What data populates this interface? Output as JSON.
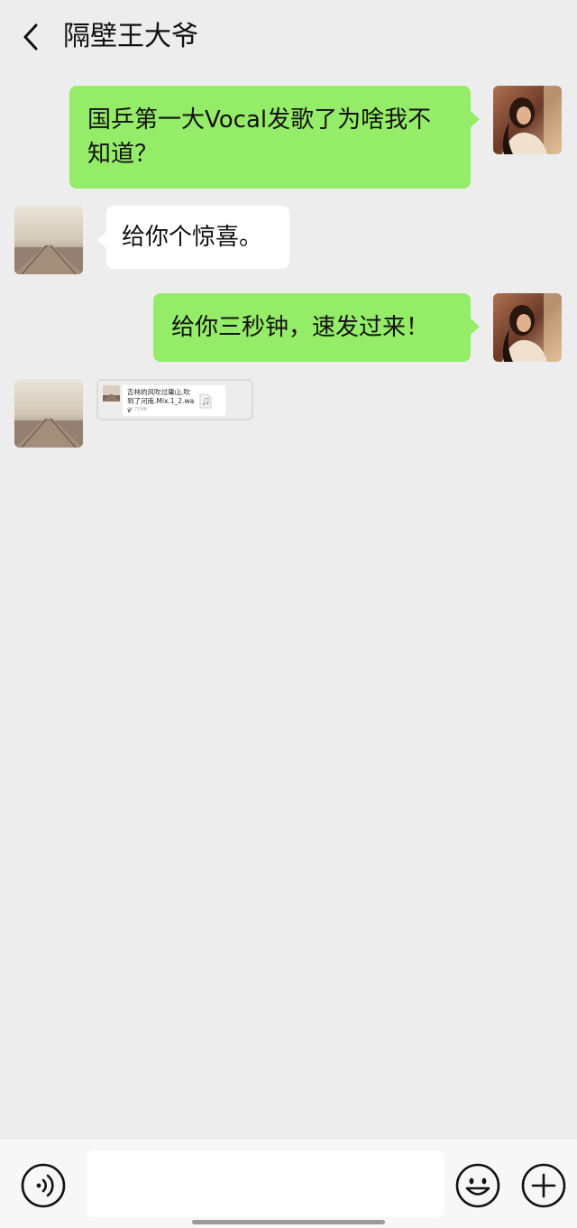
{
  "header": {
    "back_icon": "chevron-left-icon",
    "title": "隔壁王大爷"
  },
  "colors": {
    "background": "#ededed",
    "sent_bubble": "#95ec69",
    "received_bubble": "#ffffff"
  },
  "messages": [
    {
      "side": "right",
      "type": "text",
      "text": "国乒第一大Vocal发歌了为啥我不知道？"
    },
    {
      "side": "left",
      "type": "text",
      "text": "给你个惊喜。"
    },
    {
      "side": "right",
      "type": "text",
      "text": "给你三秒钟，速发过来！"
    },
    {
      "side": "left",
      "type": "file",
      "file": {
        "name": "吉林的风吹过庸山,吹到了河南.Mix.1_2.wav",
        "size": "43.71MB",
        "icon": "music-note-icon"
      }
    }
  ],
  "input_bar": {
    "voice_icon": "voice-icon",
    "input_value": "",
    "emoji_icon": "emoji-icon",
    "plus_icon": "plus-icon"
  }
}
